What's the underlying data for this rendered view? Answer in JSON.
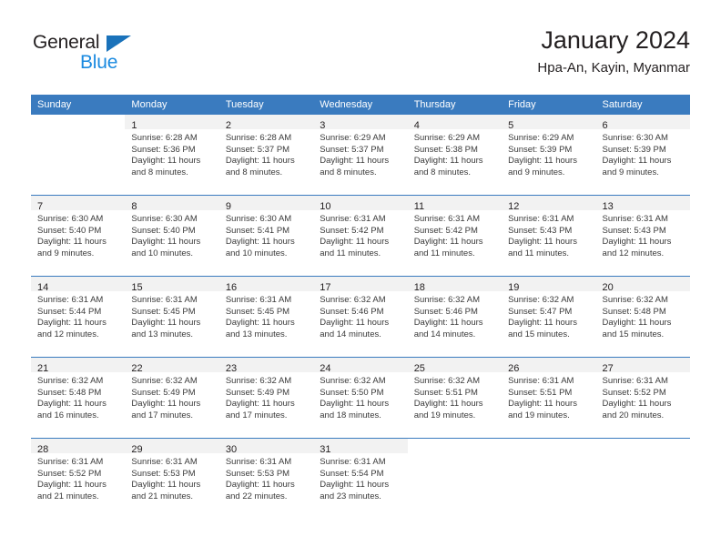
{
  "brand": {
    "name_part1": "General",
    "name_part2": "Blue",
    "color_dark": "#231f20",
    "color_blue": "#1a8ae0",
    "triangle_color": "#1a72ba"
  },
  "header": {
    "title": "January 2024",
    "subtitle": "Hpa-An, Kayin, Myanmar"
  },
  "theme": {
    "header_blue": "#3a7bbf",
    "daynum_band": "#f2f2f2",
    "text": "#231f20"
  },
  "weekday_headers": [
    "Sunday",
    "Monday",
    "Tuesday",
    "Wednesday",
    "Thursday",
    "Friday",
    "Saturday"
  ],
  "weeks": [
    [
      {
        "day": "",
        "sunrise": "",
        "sunset": "",
        "daylight_l1": "",
        "daylight_l2": ""
      },
      {
        "day": "1",
        "sunrise": "Sunrise: 6:28 AM",
        "sunset": "Sunset: 5:36 PM",
        "daylight_l1": "Daylight: 11 hours",
        "daylight_l2": "and 8 minutes."
      },
      {
        "day": "2",
        "sunrise": "Sunrise: 6:28 AM",
        "sunset": "Sunset: 5:37 PM",
        "daylight_l1": "Daylight: 11 hours",
        "daylight_l2": "and 8 minutes."
      },
      {
        "day": "3",
        "sunrise": "Sunrise: 6:29 AM",
        "sunset": "Sunset: 5:37 PM",
        "daylight_l1": "Daylight: 11 hours",
        "daylight_l2": "and 8 minutes."
      },
      {
        "day": "4",
        "sunrise": "Sunrise: 6:29 AM",
        "sunset": "Sunset: 5:38 PM",
        "daylight_l1": "Daylight: 11 hours",
        "daylight_l2": "and 8 minutes."
      },
      {
        "day": "5",
        "sunrise": "Sunrise: 6:29 AM",
        "sunset": "Sunset: 5:39 PM",
        "daylight_l1": "Daylight: 11 hours",
        "daylight_l2": "and 9 minutes."
      },
      {
        "day": "6",
        "sunrise": "Sunrise: 6:30 AM",
        "sunset": "Sunset: 5:39 PM",
        "daylight_l1": "Daylight: 11 hours",
        "daylight_l2": "and 9 minutes."
      }
    ],
    [
      {
        "day": "7",
        "sunrise": "Sunrise: 6:30 AM",
        "sunset": "Sunset: 5:40 PM",
        "daylight_l1": "Daylight: 11 hours",
        "daylight_l2": "and 9 minutes."
      },
      {
        "day": "8",
        "sunrise": "Sunrise: 6:30 AM",
        "sunset": "Sunset: 5:40 PM",
        "daylight_l1": "Daylight: 11 hours",
        "daylight_l2": "and 10 minutes."
      },
      {
        "day": "9",
        "sunrise": "Sunrise: 6:30 AM",
        "sunset": "Sunset: 5:41 PM",
        "daylight_l1": "Daylight: 11 hours",
        "daylight_l2": "and 10 minutes."
      },
      {
        "day": "10",
        "sunrise": "Sunrise: 6:31 AM",
        "sunset": "Sunset: 5:42 PM",
        "daylight_l1": "Daylight: 11 hours",
        "daylight_l2": "and 11 minutes."
      },
      {
        "day": "11",
        "sunrise": "Sunrise: 6:31 AM",
        "sunset": "Sunset: 5:42 PM",
        "daylight_l1": "Daylight: 11 hours",
        "daylight_l2": "and 11 minutes."
      },
      {
        "day": "12",
        "sunrise": "Sunrise: 6:31 AM",
        "sunset": "Sunset: 5:43 PM",
        "daylight_l1": "Daylight: 11 hours",
        "daylight_l2": "and 11 minutes."
      },
      {
        "day": "13",
        "sunrise": "Sunrise: 6:31 AM",
        "sunset": "Sunset: 5:43 PM",
        "daylight_l1": "Daylight: 11 hours",
        "daylight_l2": "and 12 minutes."
      }
    ],
    [
      {
        "day": "14",
        "sunrise": "Sunrise: 6:31 AM",
        "sunset": "Sunset: 5:44 PM",
        "daylight_l1": "Daylight: 11 hours",
        "daylight_l2": "and 12 minutes."
      },
      {
        "day": "15",
        "sunrise": "Sunrise: 6:31 AM",
        "sunset": "Sunset: 5:45 PM",
        "daylight_l1": "Daylight: 11 hours",
        "daylight_l2": "and 13 minutes."
      },
      {
        "day": "16",
        "sunrise": "Sunrise: 6:31 AM",
        "sunset": "Sunset: 5:45 PM",
        "daylight_l1": "Daylight: 11 hours",
        "daylight_l2": "and 13 minutes."
      },
      {
        "day": "17",
        "sunrise": "Sunrise: 6:32 AM",
        "sunset": "Sunset: 5:46 PM",
        "daylight_l1": "Daylight: 11 hours",
        "daylight_l2": "and 14 minutes."
      },
      {
        "day": "18",
        "sunrise": "Sunrise: 6:32 AM",
        "sunset": "Sunset: 5:46 PM",
        "daylight_l1": "Daylight: 11 hours",
        "daylight_l2": "and 14 minutes."
      },
      {
        "day": "19",
        "sunrise": "Sunrise: 6:32 AM",
        "sunset": "Sunset: 5:47 PM",
        "daylight_l1": "Daylight: 11 hours",
        "daylight_l2": "and 15 minutes."
      },
      {
        "day": "20",
        "sunrise": "Sunrise: 6:32 AM",
        "sunset": "Sunset: 5:48 PM",
        "daylight_l1": "Daylight: 11 hours",
        "daylight_l2": "and 15 minutes."
      }
    ],
    [
      {
        "day": "21",
        "sunrise": "Sunrise: 6:32 AM",
        "sunset": "Sunset: 5:48 PM",
        "daylight_l1": "Daylight: 11 hours",
        "daylight_l2": "and 16 minutes."
      },
      {
        "day": "22",
        "sunrise": "Sunrise: 6:32 AM",
        "sunset": "Sunset: 5:49 PM",
        "daylight_l1": "Daylight: 11 hours",
        "daylight_l2": "and 17 minutes."
      },
      {
        "day": "23",
        "sunrise": "Sunrise: 6:32 AM",
        "sunset": "Sunset: 5:49 PM",
        "daylight_l1": "Daylight: 11 hours",
        "daylight_l2": "and 17 minutes."
      },
      {
        "day": "24",
        "sunrise": "Sunrise: 6:32 AM",
        "sunset": "Sunset: 5:50 PM",
        "daylight_l1": "Daylight: 11 hours",
        "daylight_l2": "and 18 minutes."
      },
      {
        "day": "25",
        "sunrise": "Sunrise: 6:32 AM",
        "sunset": "Sunset: 5:51 PM",
        "daylight_l1": "Daylight: 11 hours",
        "daylight_l2": "and 19 minutes."
      },
      {
        "day": "26",
        "sunrise": "Sunrise: 6:31 AM",
        "sunset": "Sunset: 5:51 PM",
        "daylight_l1": "Daylight: 11 hours",
        "daylight_l2": "and 19 minutes."
      },
      {
        "day": "27",
        "sunrise": "Sunrise: 6:31 AM",
        "sunset": "Sunset: 5:52 PM",
        "daylight_l1": "Daylight: 11 hours",
        "daylight_l2": "and 20 minutes."
      }
    ],
    [
      {
        "day": "28",
        "sunrise": "Sunrise: 6:31 AM",
        "sunset": "Sunset: 5:52 PM",
        "daylight_l1": "Daylight: 11 hours",
        "daylight_l2": "and 21 minutes."
      },
      {
        "day": "29",
        "sunrise": "Sunrise: 6:31 AM",
        "sunset": "Sunset: 5:53 PM",
        "daylight_l1": "Daylight: 11 hours",
        "daylight_l2": "and 21 minutes."
      },
      {
        "day": "30",
        "sunrise": "Sunrise: 6:31 AM",
        "sunset": "Sunset: 5:53 PM",
        "daylight_l1": "Daylight: 11 hours",
        "daylight_l2": "and 22 minutes."
      },
      {
        "day": "31",
        "sunrise": "Sunrise: 6:31 AM",
        "sunset": "Sunset: 5:54 PM",
        "daylight_l1": "Daylight: 11 hours",
        "daylight_l2": "and 23 minutes."
      },
      {
        "day": "",
        "sunrise": "",
        "sunset": "",
        "daylight_l1": "",
        "daylight_l2": ""
      },
      {
        "day": "",
        "sunrise": "",
        "sunset": "",
        "daylight_l1": "",
        "daylight_l2": ""
      },
      {
        "day": "",
        "sunrise": "",
        "sunset": "",
        "daylight_l1": "",
        "daylight_l2": ""
      }
    ]
  ]
}
